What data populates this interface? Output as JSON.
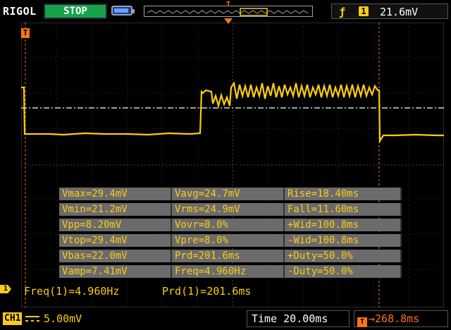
{
  "header": {
    "brand": "RIGOL",
    "run_state": "STOP",
    "trigger": {
      "edge_icon": "rising-edge-icon",
      "channel": "1",
      "level": "21.6mV"
    }
  },
  "trigger_badge": "T",
  "channel_marker": "1",
  "measurements": [
    [
      "Vmax=29.4mV",
      "Vavg=24.7mV",
      "Rise=18.40ms"
    ],
    [
      "Vmin=21.2mV",
      "Vrms=24.9mV",
      "Fall=11.60ms"
    ],
    [
      "Vpp=8.20mV",
      "Vovr=8.0%",
      "+Wid=100.8ms"
    ],
    [
      "Vtop=29.4mV",
      "Vpre=8.0%",
      "-Wid=100.8ms"
    ],
    [
      "Vbas=22.0mV",
      "Prd=201.6ms",
      "+Duty=50.0%"
    ],
    [
      "Vamp=7.41mV",
      "Freq=4.960Hz",
      "-Duty=50.0%"
    ]
  ],
  "readouts": {
    "freq": "Freq(1)=4.960Hz",
    "prd": "Prd(1)=201.6ms"
  },
  "footer": {
    "channel_label": "CH1",
    "vertical_scale": "5.00mV",
    "time_label": "Time",
    "time_scale": "20.00ms",
    "trigger_offset": "268.8ms"
  },
  "colors": {
    "trace": "#facc15",
    "trigger": "#f97316",
    "stop": "#16a34a"
  }
}
